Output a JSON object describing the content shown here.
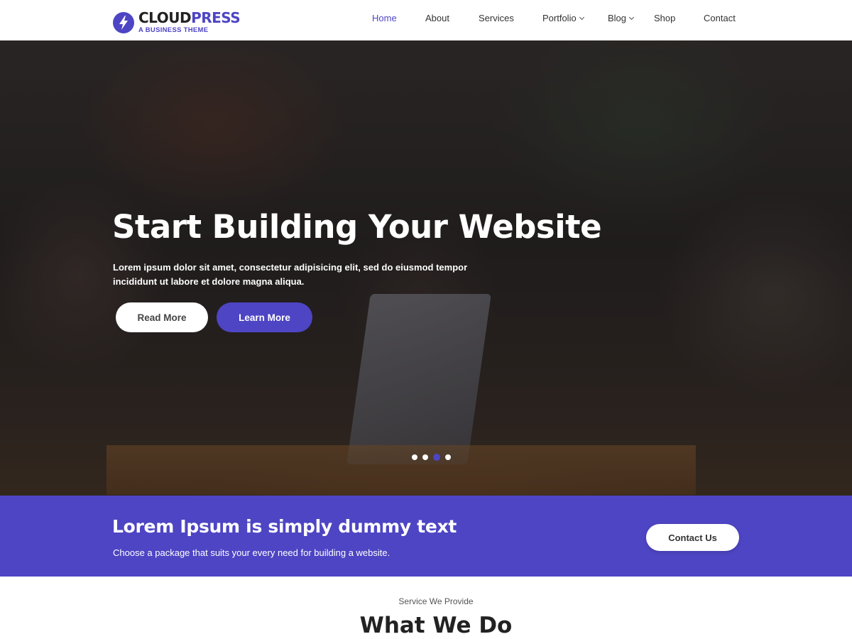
{
  "header": {
    "logo": {
      "name_part1": "CLOUD",
      "name_part2": "PRESS",
      "tagline": "A BUSINESS THEME",
      "icon": "lightning-bolt-icon"
    },
    "nav": [
      {
        "label": "Home",
        "active": true,
        "dropdown": false
      },
      {
        "label": "About",
        "active": false,
        "dropdown": false
      },
      {
        "label": "Services",
        "active": false,
        "dropdown": false
      },
      {
        "label": "Portfolio",
        "active": false,
        "dropdown": true
      },
      {
        "label": "Blog",
        "active": false,
        "dropdown": true
      },
      {
        "label": "Shop",
        "active": false,
        "dropdown": false
      },
      {
        "label": "Contact",
        "active": false,
        "dropdown": false
      }
    ]
  },
  "hero": {
    "title": "Start Building Your Website",
    "subtitle": "Lorem ipsum dolor sit amet, consectetur adipisicing elit, sed do eiusmod tempor incididunt ut labore et dolore magna aliqua.",
    "primary_button": "Read More",
    "secondary_button": "Learn More",
    "slides_total": 4,
    "active_slide": 3
  },
  "callout": {
    "title": "Lorem Ipsum is simply dummy text",
    "subtitle": "Choose a package that suits your every need for building a website.",
    "button": "Contact Us"
  },
  "services": {
    "label": "Service We Provide",
    "title": "What We Do"
  },
  "colors": {
    "accent": "#4e45c4",
    "text_dark": "#222222",
    "white": "#ffffff"
  }
}
